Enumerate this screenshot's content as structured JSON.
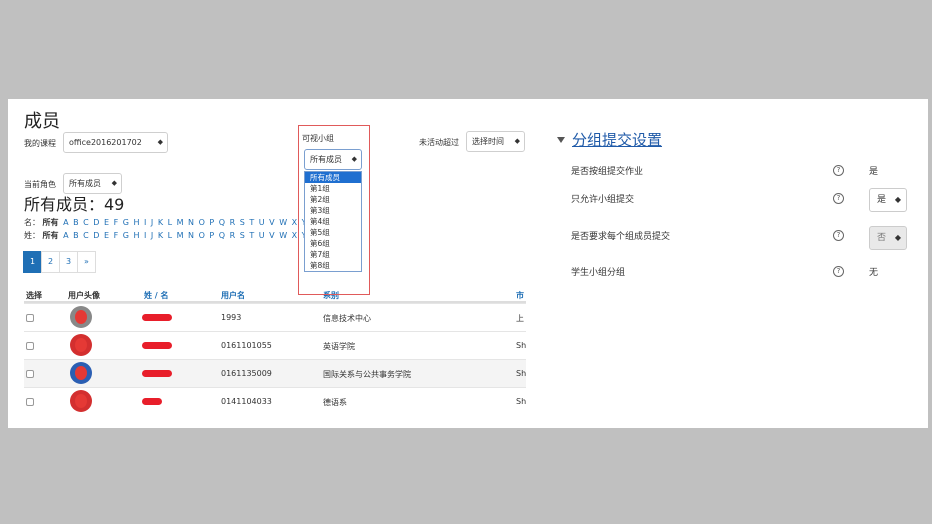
{
  "page_title": "成员",
  "filters": {
    "course_label": "我的课程",
    "course_value": "office2016201702",
    "group_label": "可视小组",
    "group_value": "所有成员",
    "inactive_label": "未活动超过",
    "inactive_value": "选择时间",
    "role_label": "当前角色",
    "role_value": "所有成员"
  },
  "caret": "◆",
  "members_heading": "所有成员：49",
  "initials": {
    "first_prefix": "名：",
    "last_prefix": "姓：",
    "all_label": "所有",
    "letters": "A B C D E F G H I J K L M N O P Q R S T U V W X Y"
  },
  "pagination": [
    "1",
    "2",
    "3",
    "»"
  ],
  "table": {
    "headers": [
      "选择",
      "用户头像",
      "姓 / 名",
      "用户名",
      "系别",
      "市"
    ],
    "rows": [
      {
        "username": "1993",
        "dept": "信息技术中心",
        "city": "上"
      },
      {
        "username": "0161101055",
        "dept": "英语学院",
        "city": "Sh"
      },
      {
        "username": "0161135009",
        "dept": "国际关系与公共事务学院",
        "city": "Sh"
      },
      {
        "username": "0141104033",
        "dept": "德语系",
        "city": "Sh"
      }
    ]
  },
  "group_dropdown": [
    "所有成员",
    "第1组",
    "第2组",
    "第3组",
    "第4组",
    "第5组",
    "第6组",
    "第7组",
    "第8组"
  ],
  "settings": {
    "title": "分组提交设置",
    "rows": [
      {
        "label": "是否按组提交作业",
        "value": "是"
      },
      {
        "label": "只允许小组提交",
        "value": "是"
      },
      {
        "label": "是否要求每个组成员提交",
        "value": "否"
      },
      {
        "label": "学生小组分组",
        "value": "无"
      }
    ]
  },
  "help_glyph": "?"
}
